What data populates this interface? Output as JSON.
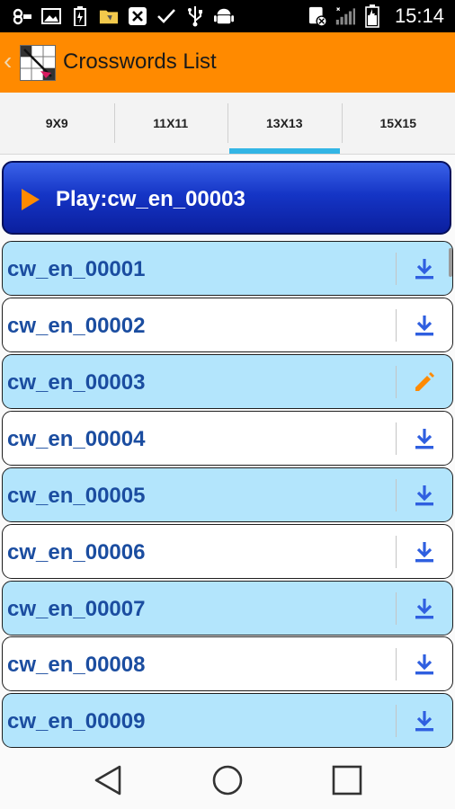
{
  "status_bar": {
    "time": "15:14",
    "left_icons": [
      "infinity-icon",
      "image-icon",
      "battery-charging-icon",
      "folder-icon",
      "close-box-icon",
      "check-icon",
      "usb-icon",
      "android-icon"
    ],
    "right_icons": [
      "sim-icon",
      "signal-icon",
      "battery-icon"
    ]
  },
  "action_bar": {
    "title": "Crosswords List",
    "back_glyph": "‹",
    "color": "#ff8a00"
  },
  "tabs": [
    {
      "label": "9X9",
      "active": false
    },
    {
      "label": "11X11",
      "active": false
    },
    {
      "label": "13X13",
      "active": true
    },
    {
      "label": "15X15",
      "active": false
    }
  ],
  "play_button": {
    "label": "Play:cw_en_00003",
    "icon": "play-arrow-icon"
  },
  "list": {
    "items": [
      {
        "name": "cw_en_00001",
        "icon": "download-icon",
        "style": "blue"
      },
      {
        "name": "cw_en_00002",
        "icon": "download-icon",
        "style": "white"
      },
      {
        "name": "cw_en_00003",
        "icon": "edit-pencil-icon",
        "style": "blue"
      },
      {
        "name": "cw_en_00004",
        "icon": "download-icon",
        "style": "white"
      },
      {
        "name": "cw_en_00005",
        "icon": "download-icon",
        "style": "blue"
      },
      {
        "name": "cw_en_00006",
        "icon": "download-icon",
        "style": "white"
      },
      {
        "name": "cw_en_00007",
        "icon": "download-icon",
        "style": "blue"
      },
      {
        "name": "cw_en_00008",
        "icon": "download-icon",
        "style": "white"
      },
      {
        "name": "cw_en_00009",
        "icon": "download-icon",
        "style": "blue"
      }
    ]
  },
  "nav_bar": {
    "buttons": [
      "back-triangle-icon",
      "home-circle-icon",
      "recents-square-icon"
    ]
  }
}
